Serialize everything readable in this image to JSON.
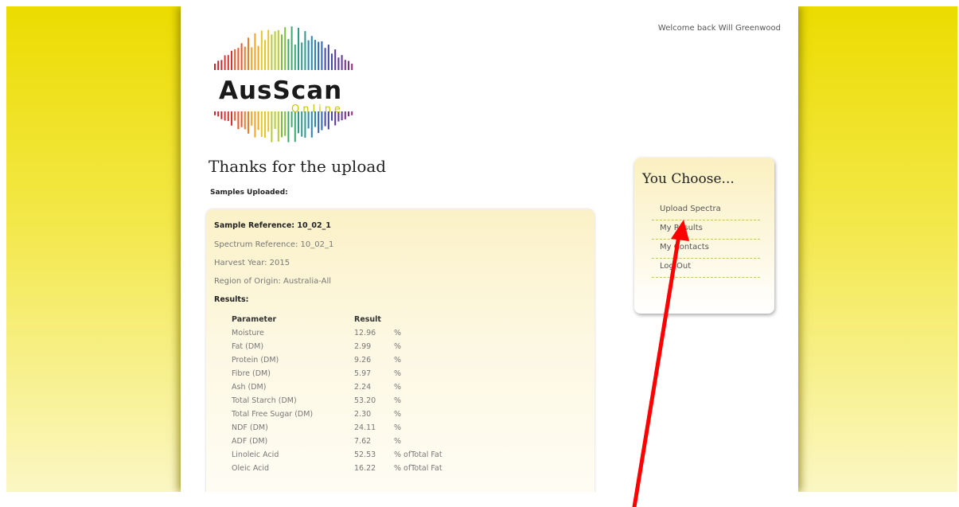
{
  "header": {
    "welcome_text": "Welcome back Will Greenwood"
  },
  "logo": {
    "title": "AusScan",
    "subtitle": "Online"
  },
  "page": {
    "title": "Thanks for the upload",
    "samples_label": "Samples Uploaded:"
  },
  "sample": {
    "reference": "Sample Reference: 10_02_1",
    "spectrum_reference": "Spectrum Reference: 10_02_1",
    "harvest_year": "Harvest Year: 2015",
    "region": "Region of Origin: Australia-All",
    "results_label": "Results:"
  },
  "results_table": {
    "headers": [
      "Parameter",
      "Result"
    ],
    "rows": [
      [
        "Moisture",
        "12.96",
        "%"
      ],
      [
        "Fat (DM)",
        "2.99",
        "%"
      ],
      [
        "Protein (DM)",
        "9.26",
        "%"
      ],
      [
        "Fibre (DM)",
        "5.97",
        "%"
      ],
      [
        "Ash (DM)",
        "2.24",
        "%"
      ],
      [
        "Total Starch (DM)",
        "53.20",
        "%"
      ],
      [
        "Total Free Sugar (DM)",
        "2.30",
        "%"
      ],
      [
        "NDF (DM)",
        "24.11",
        "%"
      ],
      [
        "ADF (DM)",
        "7.62",
        "%"
      ],
      [
        "Linoleic Acid",
        "52.53",
        "% ofTotal Fat"
      ],
      [
        "Oleic Acid",
        "16.22",
        "% ofTotal Fat"
      ]
    ]
  },
  "sidebar": {
    "title": "You Choose...",
    "items": [
      "Upload Spectra",
      "My Results",
      "My Contacts",
      "Log Out"
    ]
  },
  "annotation": {
    "arrow_color": "#ff0000"
  },
  "colors": {
    "background_yellow": "#ecdc00",
    "panel_cream": "#fbf1c7"
  }
}
